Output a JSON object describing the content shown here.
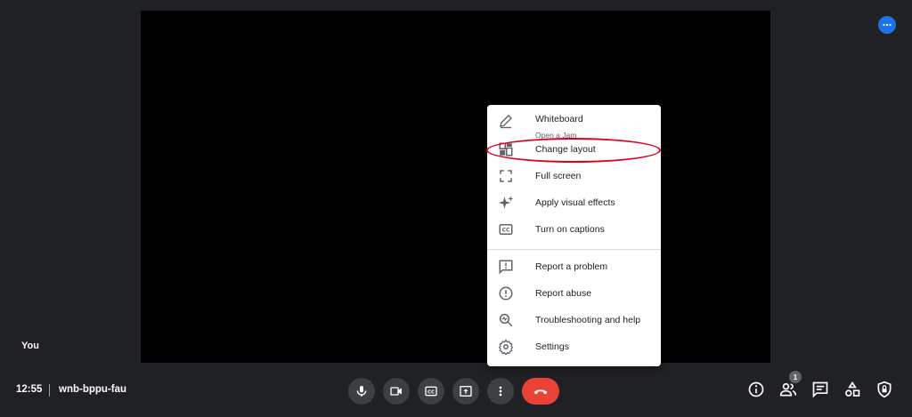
{
  "self_tile": {
    "name": "You"
  },
  "menu": {
    "items": [
      {
        "label": "Whiteboard",
        "sublabel": "Open a Jam",
        "icon": "pencil-icon"
      },
      {
        "label": "Change layout",
        "icon": "layout-icon"
      },
      {
        "label": "Full screen",
        "icon": "fullscreen-icon"
      },
      {
        "label": "Apply visual effects",
        "icon": "sparkle-icon"
      },
      {
        "label": "Turn on captions",
        "icon": "captions-icon"
      },
      {
        "label": "Report a problem",
        "icon": "feedback-icon"
      },
      {
        "label": "Report abuse",
        "icon": "alert-icon"
      },
      {
        "label": "Troubleshooting and help",
        "icon": "troubleshoot-icon"
      },
      {
        "label": "Settings",
        "icon": "gear-icon"
      }
    ]
  },
  "bottom_bar": {
    "time": "12:55",
    "meeting_code": "wnb-bppu-fau",
    "participant_count": "1"
  },
  "colors": {
    "background": "#202124",
    "control_button": "#3c4043",
    "end_call": "#ea4335",
    "accent": "#1a73e8",
    "annotation": "#e0001b"
  }
}
